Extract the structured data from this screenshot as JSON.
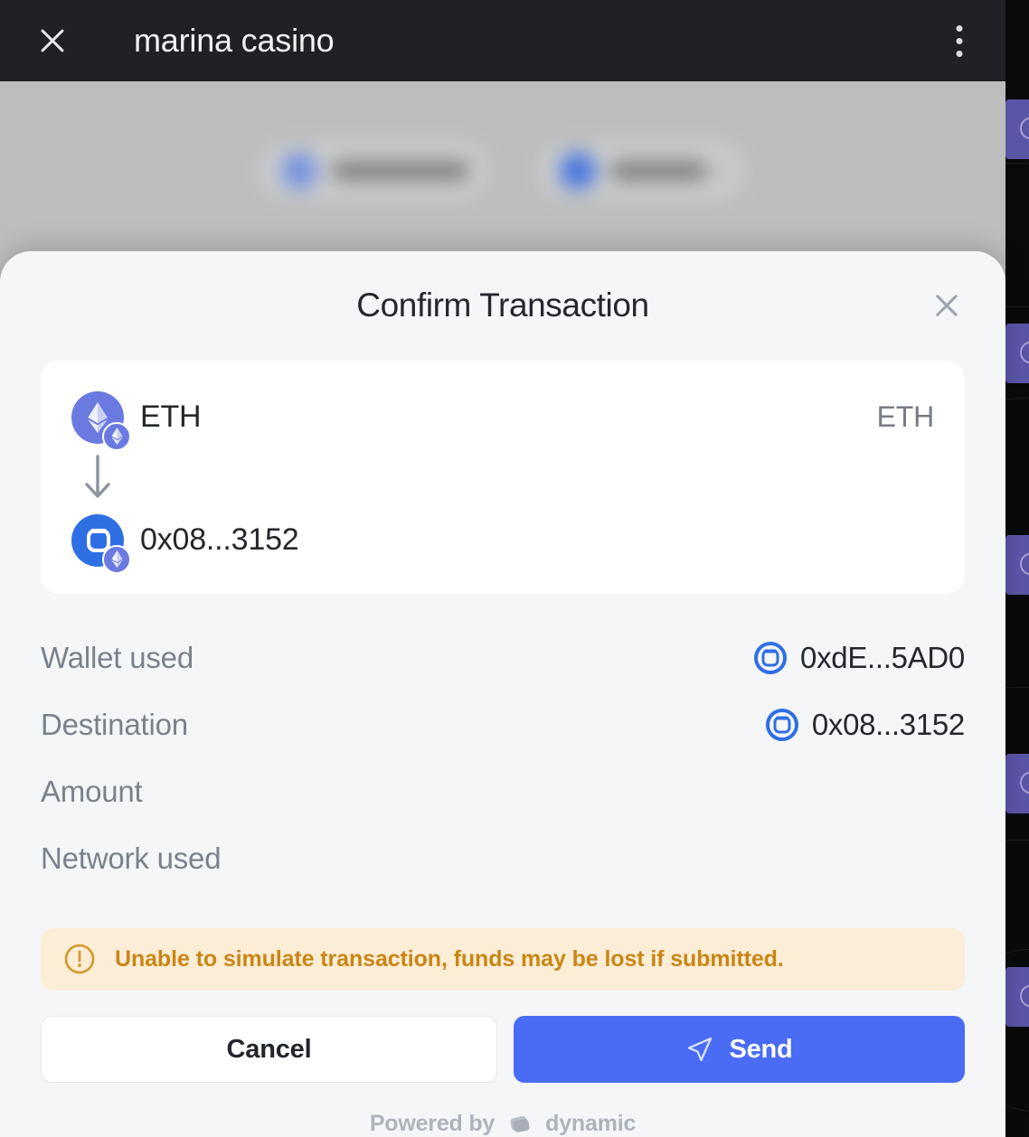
{
  "browser": {
    "title": "marina casino",
    "close_icon": "close-icon",
    "menu_icon": "overflow-menu-icon"
  },
  "modal": {
    "title": "Confirm Transaction",
    "close_icon": "close-icon",
    "transfer_card": {
      "token_symbol": "ETH",
      "token_icon": "ethereum-token-icon",
      "token_badge_icon": "ethereum-network-badge-icon",
      "amount_right": "ETH",
      "arrow_icon": "arrow-down-icon",
      "destination_label": "0x08...3152",
      "destination_icon": "contract-address-icon",
      "destination_badge_icon": "ethereum-network-badge-icon"
    },
    "details": [
      {
        "key": "Wallet used",
        "value": "0xdE...5AD0",
        "icon": "wallet-icon"
      },
      {
        "key": "Destination",
        "value": "0x08...3152",
        "icon": "wallet-icon"
      },
      {
        "key": "Amount",
        "value": "",
        "icon": ""
      },
      {
        "key": "Network used",
        "value": "",
        "icon": ""
      }
    ],
    "warning": {
      "icon": "alert-circle-icon",
      "text": "Unable to simulate transaction, funds may be lost if submitted."
    },
    "buttons": {
      "cancel": "Cancel",
      "send": "Send",
      "send_icon": "paper-plane-icon"
    },
    "footer": {
      "text": "Powered by",
      "brand": "dynamic",
      "logo_icon": "dynamic-logo-icon"
    }
  },
  "colors": {
    "accent_blue": "#4a6cf4",
    "eth_purple": "#6a7ae0",
    "address_blue": "#2f6fe4",
    "warning_bg": "#fcedd6",
    "warning_fg": "#c98616",
    "sheet_bg": "#f5f6f8",
    "topbar_bg": "#202124"
  }
}
